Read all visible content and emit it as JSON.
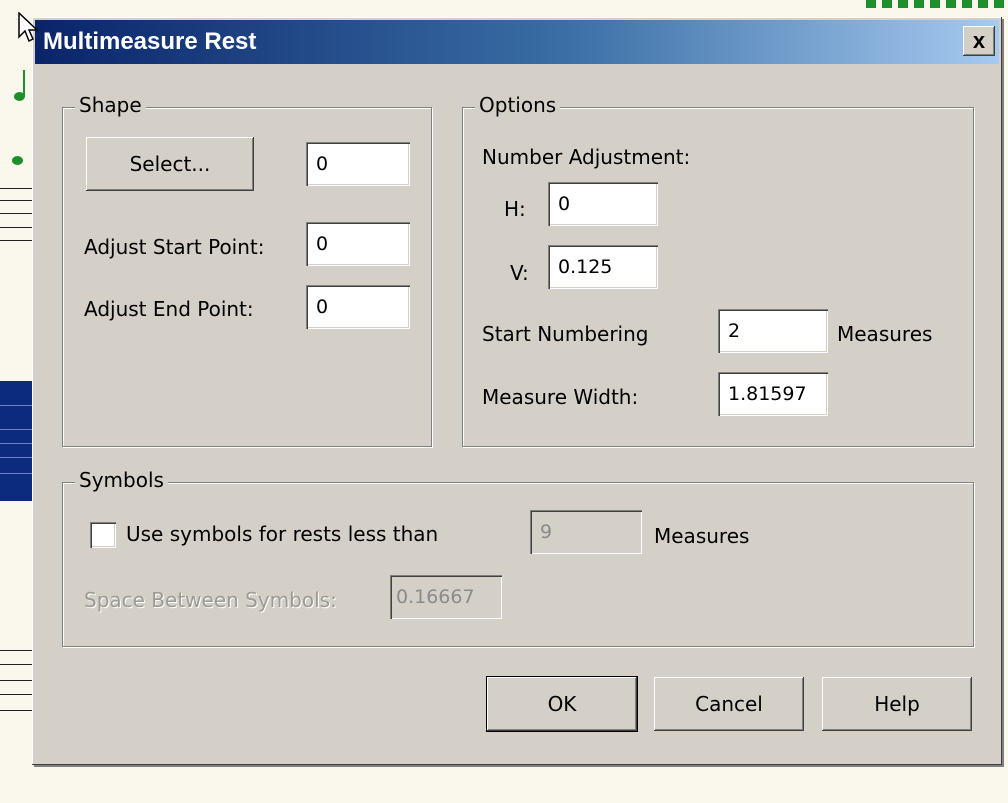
{
  "window": {
    "title": "Multimeasure Rest",
    "close_glyph": "✕",
    "close_label": "x"
  },
  "shape": {
    "legend": "Shape",
    "select_label": "Select...",
    "shape_id_value": "0",
    "adjust_start_label": "Adjust Start Point:",
    "adjust_start_value": "0",
    "adjust_end_label": "Adjust End Point:",
    "adjust_end_value": "0"
  },
  "options": {
    "legend": "Options",
    "number_adjustment_label": "Number Adjustment:",
    "h_label": "H:",
    "h_value": "0",
    "v_label": "V:",
    "v_value": "0.125",
    "start_numbering_label": "Start Numbering",
    "start_numbering_value": "2",
    "start_numbering_unit": "Measures",
    "measure_width_label": "Measure Width:",
    "measure_width_value": "1.81597"
  },
  "symbols": {
    "legend": "Symbols",
    "use_symbols_label": "Use symbols for rests less than",
    "use_symbols_checked": false,
    "use_symbols_value": "9",
    "use_symbols_unit": "Measures",
    "space_between_label": "Space Between Symbols:",
    "space_between_value": "0.16667"
  },
  "buttons": {
    "ok": "OK",
    "cancel": "Cancel",
    "help": "Help"
  },
  "colors": {
    "dialog_bg": "#d4d0c8",
    "titlebar_start": "#0a246a",
    "titlebar_end": "#a6caf0",
    "note_green": "#1e8f2a"
  },
  "icons": {
    "cursor": "arrow-cursor-icon",
    "close": "close-icon"
  }
}
